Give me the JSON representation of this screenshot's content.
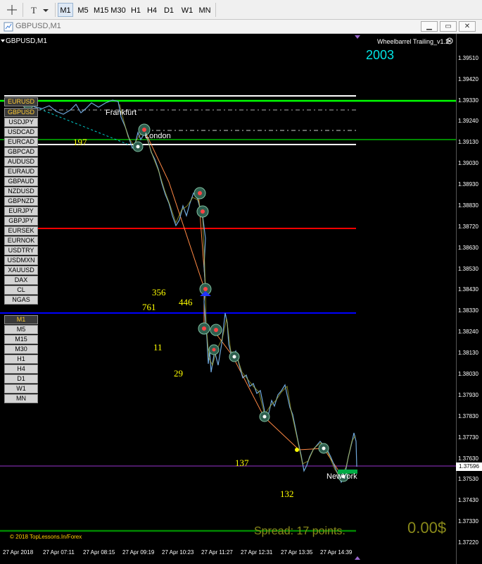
{
  "toolbar": {
    "timeframes": [
      "M1",
      "M5",
      "M15",
      "M30",
      "H1",
      "H4",
      "D1",
      "W1",
      "MN"
    ],
    "active": "M1"
  },
  "window": {
    "title": "GBPUSD,M1"
  },
  "chart": {
    "symbol_label": "GBPUSD,M1",
    "indicator_title": "Wheelbarrel Trailing_v1.2",
    "big_number": "2003",
    "current_price": "1.37596",
    "price_labels": [
      "1.39510",
      "1.39420",
      "1.39330",
      "1.39240",
      "1.39130",
      "1.39030",
      "1.38930",
      "1.38830",
      "1.38720",
      "1.38630",
      "1.38530",
      "1.38430",
      "1.38330",
      "1.38240",
      "1.38130",
      "1.38030",
      "1.37930",
      "1.37830",
      "1.37730",
      "1.37630",
      "1.37530",
      "1.37430",
      "1.37330",
      "1.37220"
    ],
    "time_labels": [
      "27 Apr 2018",
      "27 Apr 07:11",
      "27 Apr 08:15",
      "27 Apr 09:19",
      "27 Apr 10:23",
      "27 Apr 11:27",
      "27 Apr 12:31",
      "27 Apr 13:35",
      "27 Apr 14:39"
    ],
    "cities": {
      "frankfurt": "Frankfurt",
      "london": "London",
      "newyork": "NewYork"
    },
    "annotations": {
      "a1": "197",
      "a2": "356",
      "a3": "446",
      "a4": "761",
      "a5": "11",
      "a6": "29",
      "a7": "137",
      "a8": "132"
    },
    "copyright": "© 2018 TopLessons.In/Forex",
    "spread": "Spread: 17 points.",
    "profit": "0.00$",
    "symbols": [
      "EURUSD",
      "GBPUSD",
      "USDJPY",
      "USDCAD",
      "EURCAD",
      "GBPCAD",
      "AUDUSD",
      "EURAUD",
      "GBPAUD",
      "NZDUSD",
      "GBPNZD",
      "EURJPY",
      "GBPJPY",
      "EURSEK",
      "EURNOK",
      "USDTRY",
      "USDMXN",
      "XAUUSD",
      "DAX",
      "CL",
      "NGAS"
    ],
    "tf_buttons": [
      "M1",
      "M5",
      "M15",
      "M30",
      "H1",
      "H4",
      "D1",
      "W1",
      "MN"
    ],
    "colors": {
      "green": "#00ff00",
      "red": "#ff0000",
      "blue": "#0000ff",
      "white": "#ffffff",
      "purple": "#9933cc",
      "price": "#6fa8dc"
    }
  }
}
